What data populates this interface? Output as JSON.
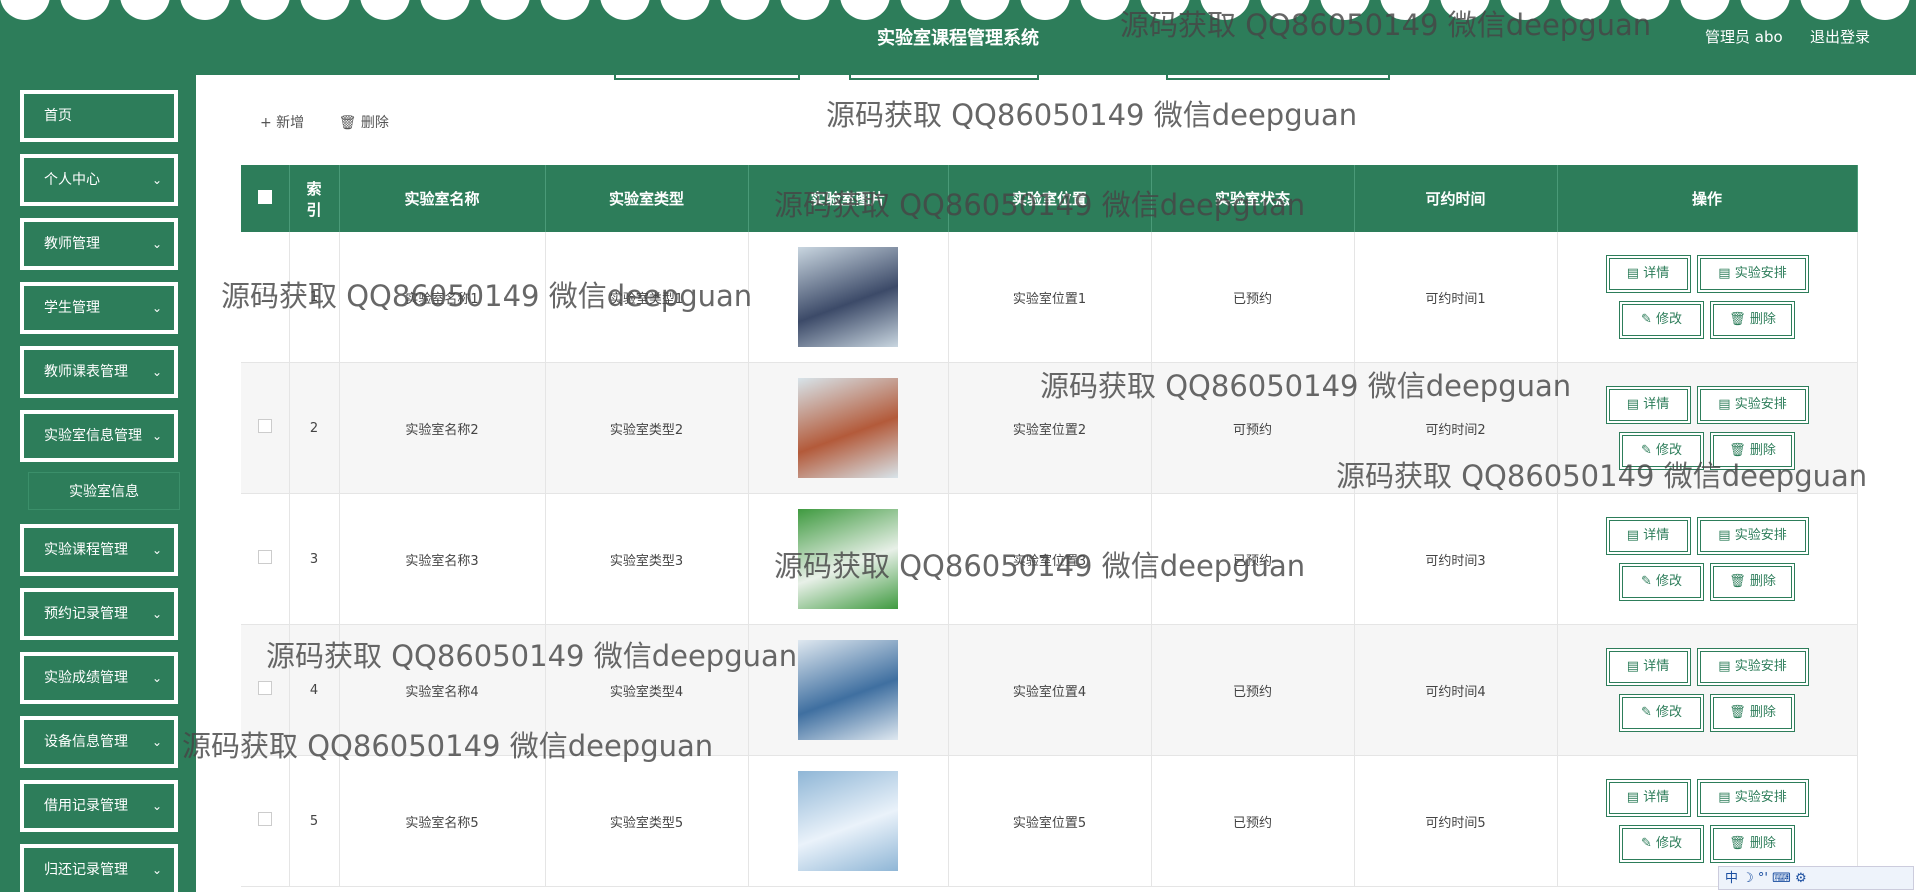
{
  "header": {
    "title": "实验室课程管理系统",
    "user": "管理员 abo",
    "logout": "退出登录"
  },
  "sidebar": {
    "items": [
      {
        "label": "首页"
      },
      {
        "label": "个人中心"
      },
      {
        "label": "教师管理"
      },
      {
        "label": "学生管理"
      },
      {
        "label": "教师课表管理"
      },
      {
        "label": "实验室信息管理"
      },
      {
        "label": "实验课程管理"
      },
      {
        "label": "预约记录管理"
      },
      {
        "label": "实验成绩管理"
      },
      {
        "label": "设备信息管理"
      },
      {
        "label": "借用记录管理"
      },
      {
        "label": "归还记录管理"
      }
    ],
    "submenu": {
      "label": "实验室信息"
    }
  },
  "toolbar": {
    "add": "+ 新增",
    "delete": "🗑 删除"
  },
  "table": {
    "headers": [
      "",
      "索\n引",
      "实验室名称",
      "实验室类型",
      "实验室图片",
      "实验室位置",
      "实验室状态",
      "可约时间",
      "操作"
    ],
    "rows": [
      {
        "index": "1",
        "name": "实验室名称1",
        "type": "实验室类型1",
        "location": "实验室位置1",
        "status": "已预约",
        "time": "可约时间1"
      },
      {
        "index": "2",
        "name": "实验室名称2",
        "type": "实验室类型2",
        "location": "实验室位置2",
        "status": "可预约",
        "time": "可约时间2"
      },
      {
        "index": "3",
        "name": "实验室名称3",
        "type": "实验室类型3",
        "location": "实验室位置3",
        "status": "已预约",
        "time": "可约时间3"
      },
      {
        "index": "4",
        "name": "实验室名称4",
        "type": "实验室类型4",
        "location": "实验室位置4",
        "status": "已预约",
        "time": "可约时间4"
      },
      {
        "index": "5",
        "name": "实验室名称5",
        "type": "实验室类型5",
        "location": "实验室位置5",
        "status": "已预约",
        "time": "可约时间5"
      }
    ],
    "actions": {
      "detail": "详情",
      "arrange": "实验安排",
      "edit": "修改",
      "delete": "删除"
    }
  },
  "watermark": "源码获取 QQ86050149 微信deepguan",
  "ime": "中 ☽ °' ⌨ ⚙"
}
